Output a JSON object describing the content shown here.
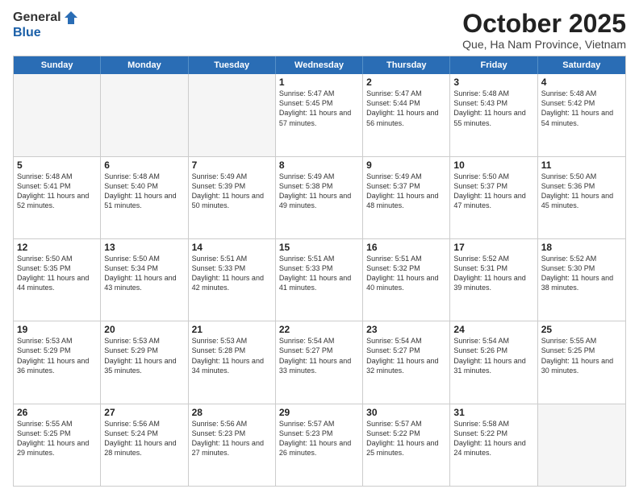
{
  "header": {
    "logo_general": "General",
    "logo_blue": "Blue",
    "month_title": "October 2025",
    "subtitle": "Que, Ha Nam Province, Vietnam"
  },
  "days_of_week": [
    "Sunday",
    "Monday",
    "Tuesday",
    "Wednesday",
    "Thursday",
    "Friday",
    "Saturday"
  ],
  "weeks": [
    [
      {
        "day": "",
        "text": "",
        "empty": true
      },
      {
        "day": "",
        "text": "",
        "empty": true
      },
      {
        "day": "",
        "text": "",
        "empty": true
      },
      {
        "day": "1",
        "text": "Sunrise: 5:47 AM\nSunset: 5:45 PM\nDaylight: 11 hours and 57 minutes."
      },
      {
        "day": "2",
        "text": "Sunrise: 5:47 AM\nSunset: 5:44 PM\nDaylight: 11 hours and 56 minutes."
      },
      {
        "day": "3",
        "text": "Sunrise: 5:48 AM\nSunset: 5:43 PM\nDaylight: 11 hours and 55 minutes."
      },
      {
        "day": "4",
        "text": "Sunrise: 5:48 AM\nSunset: 5:42 PM\nDaylight: 11 hours and 54 minutes."
      }
    ],
    [
      {
        "day": "5",
        "text": "Sunrise: 5:48 AM\nSunset: 5:41 PM\nDaylight: 11 hours and 52 minutes."
      },
      {
        "day": "6",
        "text": "Sunrise: 5:48 AM\nSunset: 5:40 PM\nDaylight: 11 hours and 51 minutes."
      },
      {
        "day": "7",
        "text": "Sunrise: 5:49 AM\nSunset: 5:39 PM\nDaylight: 11 hours and 50 minutes."
      },
      {
        "day": "8",
        "text": "Sunrise: 5:49 AM\nSunset: 5:38 PM\nDaylight: 11 hours and 49 minutes."
      },
      {
        "day": "9",
        "text": "Sunrise: 5:49 AM\nSunset: 5:37 PM\nDaylight: 11 hours and 48 minutes."
      },
      {
        "day": "10",
        "text": "Sunrise: 5:50 AM\nSunset: 5:37 PM\nDaylight: 11 hours and 47 minutes."
      },
      {
        "day": "11",
        "text": "Sunrise: 5:50 AM\nSunset: 5:36 PM\nDaylight: 11 hours and 45 minutes."
      }
    ],
    [
      {
        "day": "12",
        "text": "Sunrise: 5:50 AM\nSunset: 5:35 PM\nDaylight: 11 hours and 44 minutes."
      },
      {
        "day": "13",
        "text": "Sunrise: 5:50 AM\nSunset: 5:34 PM\nDaylight: 11 hours and 43 minutes."
      },
      {
        "day": "14",
        "text": "Sunrise: 5:51 AM\nSunset: 5:33 PM\nDaylight: 11 hours and 42 minutes."
      },
      {
        "day": "15",
        "text": "Sunrise: 5:51 AM\nSunset: 5:33 PM\nDaylight: 11 hours and 41 minutes."
      },
      {
        "day": "16",
        "text": "Sunrise: 5:51 AM\nSunset: 5:32 PM\nDaylight: 11 hours and 40 minutes."
      },
      {
        "day": "17",
        "text": "Sunrise: 5:52 AM\nSunset: 5:31 PM\nDaylight: 11 hours and 39 minutes."
      },
      {
        "day": "18",
        "text": "Sunrise: 5:52 AM\nSunset: 5:30 PM\nDaylight: 11 hours and 38 minutes."
      }
    ],
    [
      {
        "day": "19",
        "text": "Sunrise: 5:53 AM\nSunset: 5:29 PM\nDaylight: 11 hours and 36 minutes."
      },
      {
        "day": "20",
        "text": "Sunrise: 5:53 AM\nSunset: 5:29 PM\nDaylight: 11 hours and 35 minutes."
      },
      {
        "day": "21",
        "text": "Sunrise: 5:53 AM\nSunset: 5:28 PM\nDaylight: 11 hours and 34 minutes."
      },
      {
        "day": "22",
        "text": "Sunrise: 5:54 AM\nSunset: 5:27 PM\nDaylight: 11 hours and 33 minutes."
      },
      {
        "day": "23",
        "text": "Sunrise: 5:54 AM\nSunset: 5:27 PM\nDaylight: 11 hours and 32 minutes."
      },
      {
        "day": "24",
        "text": "Sunrise: 5:54 AM\nSunset: 5:26 PM\nDaylight: 11 hours and 31 minutes."
      },
      {
        "day": "25",
        "text": "Sunrise: 5:55 AM\nSunset: 5:25 PM\nDaylight: 11 hours and 30 minutes."
      }
    ],
    [
      {
        "day": "26",
        "text": "Sunrise: 5:55 AM\nSunset: 5:25 PM\nDaylight: 11 hours and 29 minutes."
      },
      {
        "day": "27",
        "text": "Sunrise: 5:56 AM\nSunset: 5:24 PM\nDaylight: 11 hours and 28 minutes."
      },
      {
        "day": "28",
        "text": "Sunrise: 5:56 AM\nSunset: 5:23 PM\nDaylight: 11 hours and 27 minutes."
      },
      {
        "day": "29",
        "text": "Sunrise: 5:57 AM\nSunset: 5:23 PM\nDaylight: 11 hours and 26 minutes."
      },
      {
        "day": "30",
        "text": "Sunrise: 5:57 AM\nSunset: 5:22 PM\nDaylight: 11 hours and 25 minutes."
      },
      {
        "day": "31",
        "text": "Sunrise: 5:58 AM\nSunset: 5:22 PM\nDaylight: 11 hours and 24 minutes."
      },
      {
        "day": "",
        "text": "",
        "empty": true
      }
    ]
  ]
}
